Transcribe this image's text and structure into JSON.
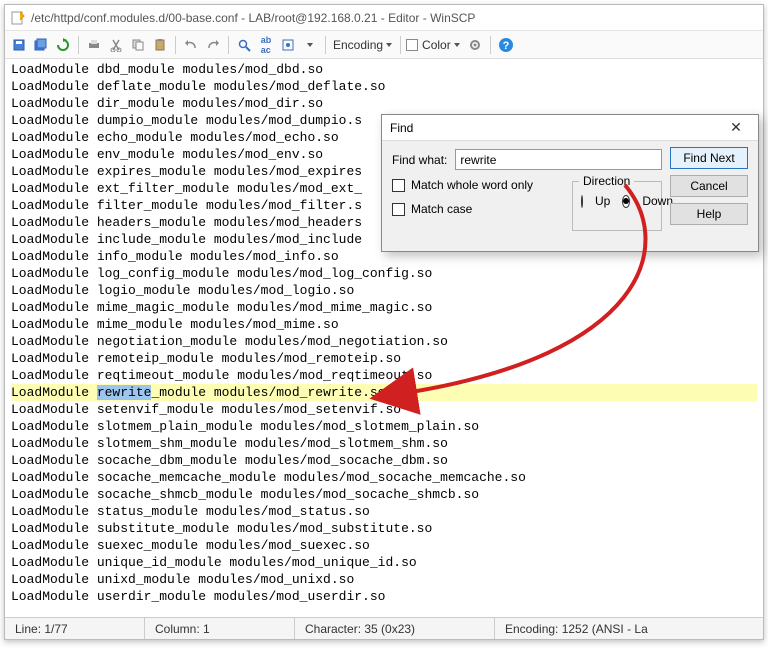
{
  "title": "/etc/httpd/conf.modules.d/00-base.conf - LAB/root@192.168.0.21 - Editor - WinSCP",
  "toolbar": {
    "encoding_label": "Encoding",
    "color_label": "Color"
  },
  "lines": [
    "LoadModule dbd_module modules/mod_dbd.so",
    "LoadModule deflate_module modules/mod_deflate.so",
    "LoadModule dir_module modules/mod_dir.so",
    "LoadModule dumpio_module modules/mod_dumpio.s",
    "LoadModule echo_module modules/mod_echo.so",
    "LoadModule env_module modules/mod_env.so",
    "LoadModule expires_module modules/mod_expires",
    "LoadModule ext_filter_module modules/mod_ext_",
    "LoadModule filter_module modules/mod_filter.s",
    "LoadModule headers_module modules/mod_headers",
    "LoadModule include_module modules/mod_include",
    "LoadModule info_module modules/mod_info.so",
    "LoadModule log_config_module modules/mod_log_config.so",
    "LoadModule logio_module modules/mod_logio.so",
    "LoadModule mime_magic_module modules/mod_mime_magic.so",
    "LoadModule mime_module modules/mod_mime.so",
    "LoadModule negotiation_module modules/mod_negotiation.so",
    "LoadModule remoteip_module modules/mod_remoteip.so",
    "LoadModule reqtimeout_module modules/mod_reqtimeout.so",
    "LoadModule rewrite_module modules/mod_rewrite.so",
    "LoadModule setenvif_module modules/mod_setenvif.so",
    "LoadModule slotmem_plain_module modules/mod_slotmem_plain.so",
    "LoadModule slotmem_shm_module modules/mod_slotmem_shm.so",
    "LoadModule socache_dbm_module modules/mod_socache_dbm.so",
    "LoadModule socache_memcache_module modules/mod_socache_memcache.so",
    "LoadModule socache_shmcb_module modules/mod_socache_shmcb.so",
    "LoadModule status_module modules/mod_status.so",
    "LoadModule substitute_module modules/mod_substitute.so",
    "LoadModule suexec_module modules/mod_suexec.so",
    "LoadModule unique_id_module modules/mod_unique_id.so",
    "LoadModule unixd_module modules/mod_unixd.so",
    "LoadModule userdir_module modules/mod_userdir.so"
  ],
  "highlight": {
    "lineIndex": 19,
    "prefix": "LoadModule ",
    "match": "rewrite",
    "suffix": "_module modules/mod_rewrite.so"
  },
  "find": {
    "title": "Find",
    "label": "Find what:",
    "value": "rewrite",
    "match_word": "Match whole word only",
    "match_case": "Match case",
    "direction": "Direction",
    "up": "Up",
    "down": "Down",
    "find_next": "Find Next",
    "cancel": "Cancel",
    "help": "Help"
  },
  "status": {
    "line": "Line: 1/77",
    "column": "Column: 1",
    "character": "Character: 35 (0x23)",
    "encoding": "Encoding: 1252 (ANSI - La"
  }
}
